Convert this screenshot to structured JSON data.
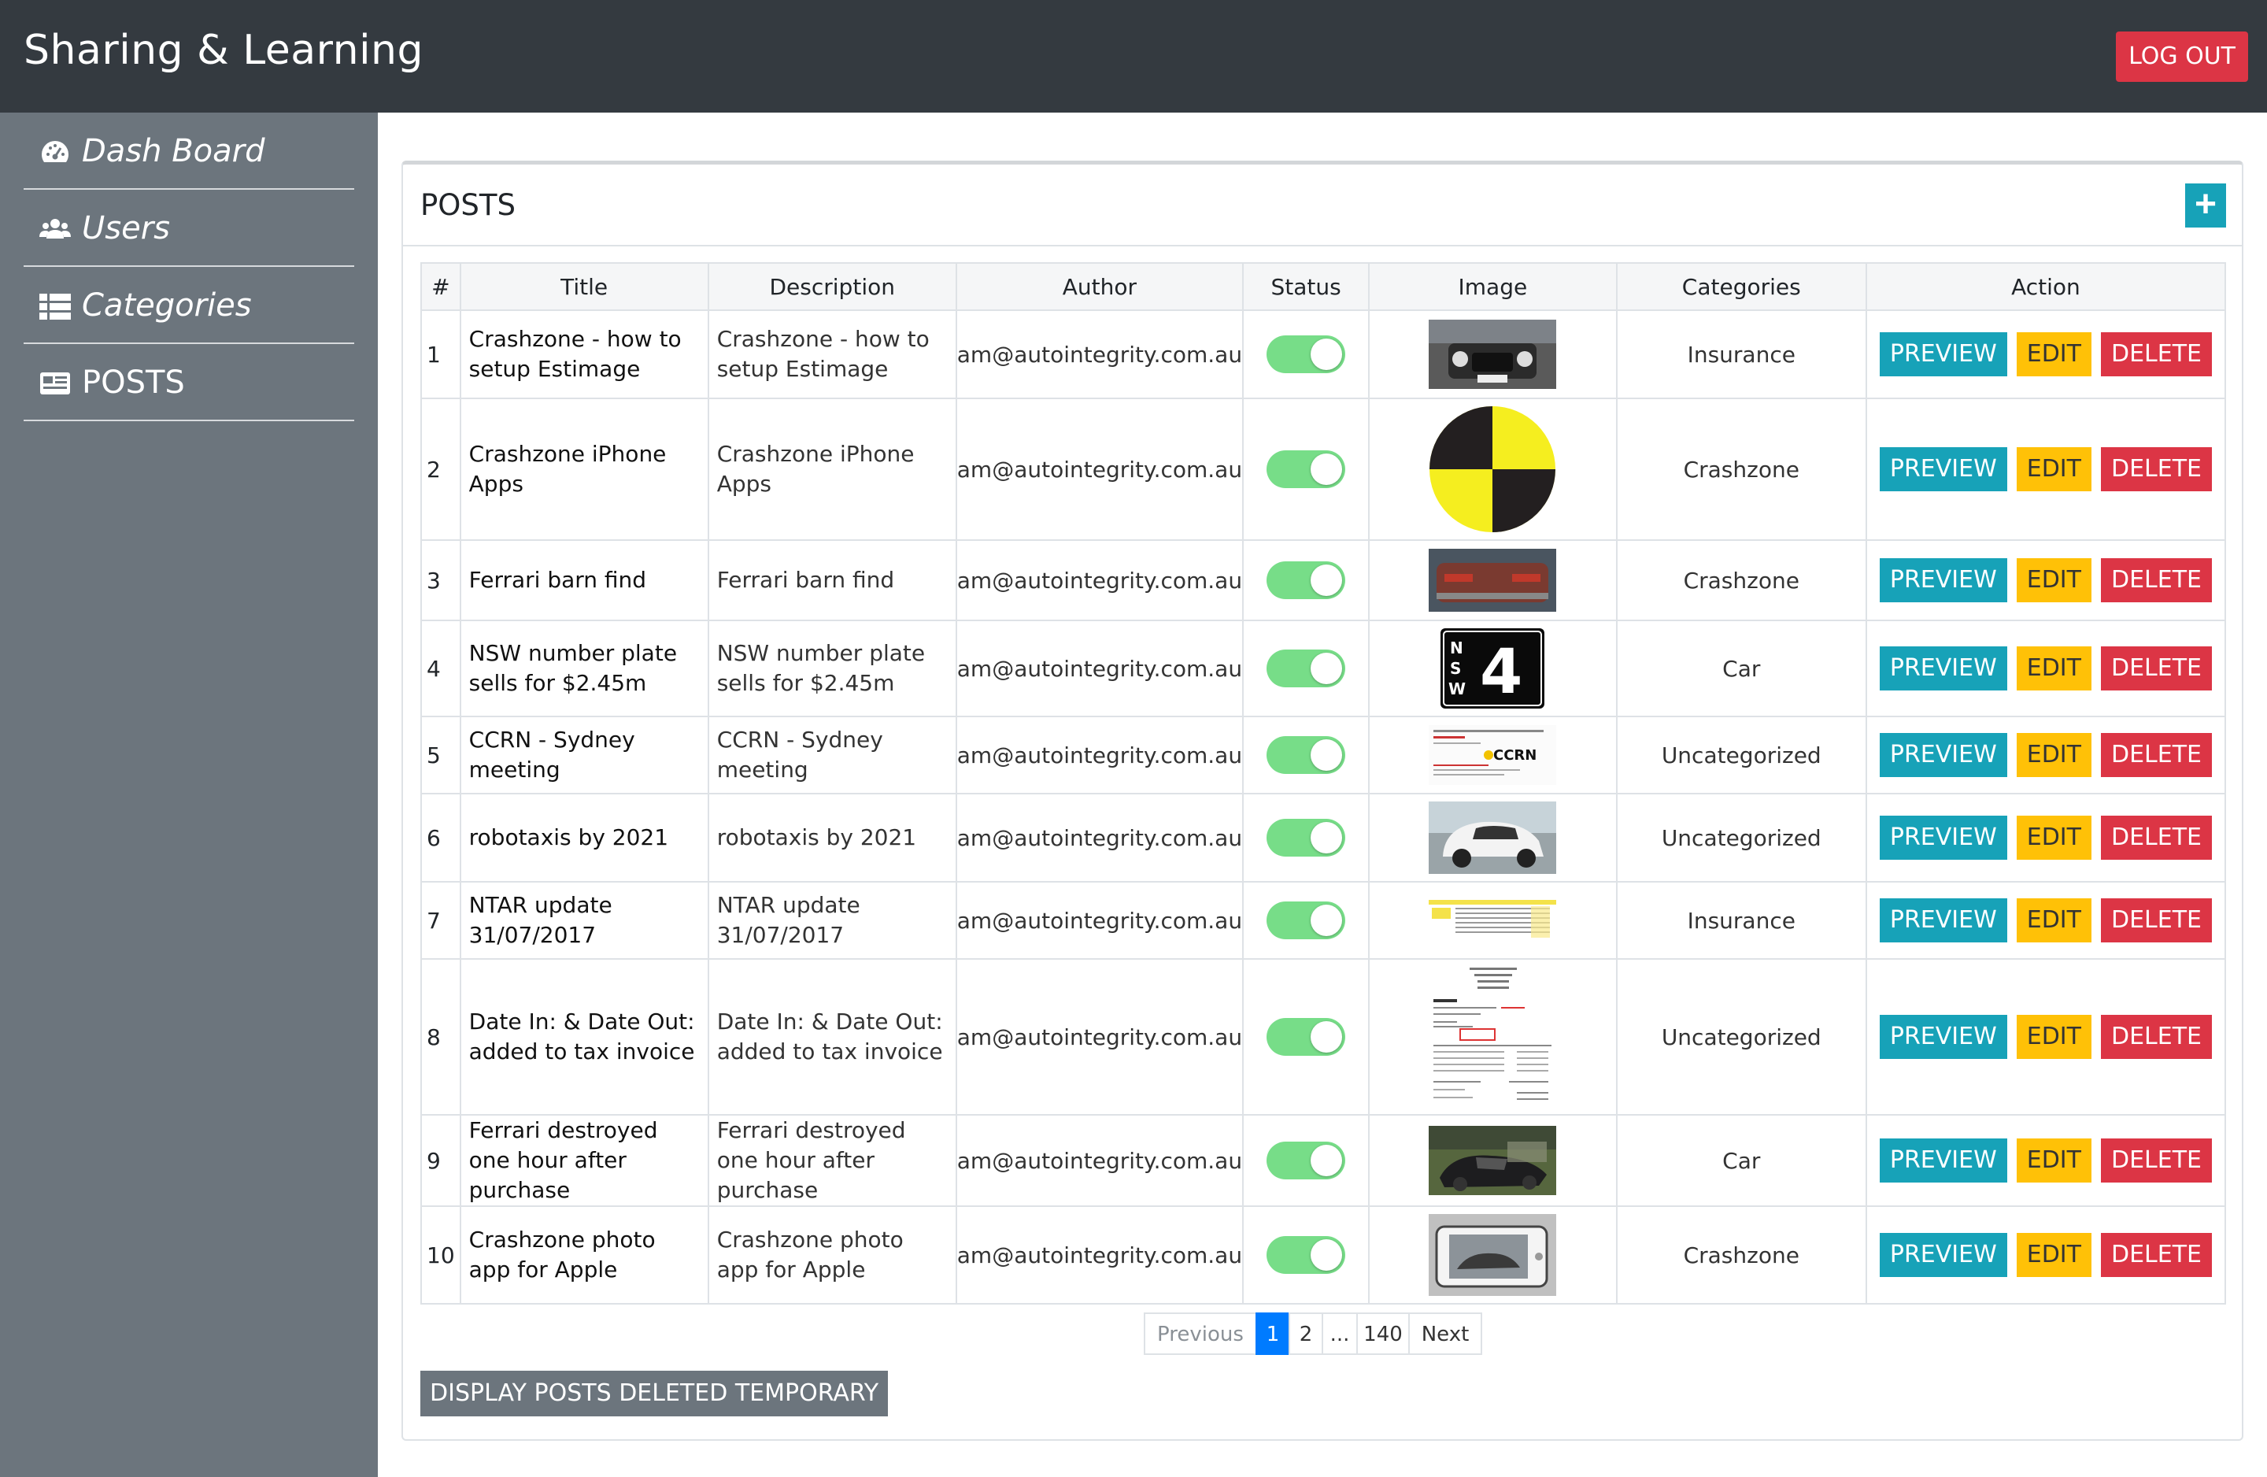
{
  "app": {
    "title": "Sharing & Learning",
    "logout_label": "LOG OUT"
  },
  "sidebar": {
    "items": [
      {
        "label": "Dash Board",
        "icon": "dashboard-icon"
      },
      {
        "label": "Users",
        "icon": "users-icon"
      },
      {
        "label": "Categories",
        "icon": "categories-icon"
      },
      {
        "label": "POSTS",
        "icon": "posts-icon",
        "active": true
      }
    ]
  },
  "posts": {
    "title": "POSTS",
    "add_label": "+",
    "columns": [
      "#",
      "Title",
      "Description",
      "Author",
      "Status",
      "Image",
      "Categories",
      "Action"
    ],
    "actions": {
      "preview": "PREVIEW",
      "edit": "EDIT",
      "delete": "DELETE"
    },
    "rows": [
      {
        "num": "1",
        "title": "Crashzone - how to setup Estimage",
        "description": "Crashzone - how to setup Estimage",
        "author": "am@autointegrity.com.au",
        "status": true,
        "image": "car-front-image",
        "category": "Insurance"
      },
      {
        "num": "2",
        "title": "Crashzone iPhone Apps",
        "description": "Crashzone iPhone Apps",
        "author": "am@autointegrity.com.au",
        "status": true,
        "image": "crash-test-symbol-image",
        "category": "Crashzone"
      },
      {
        "num": "3",
        "title": "Ferrari barn find",
        "description": "Ferrari barn find",
        "author": "am@autointegrity.com.au",
        "status": true,
        "image": "ferrari-rear-image",
        "category": "Crashzone"
      },
      {
        "num": "4",
        "title": "NSW number plate sells for $2.45m",
        "description": "NSW number plate sells for $2.45m",
        "author": "am@autointegrity.com.au",
        "status": true,
        "image": "nsw-plate-image",
        "category": "Car"
      },
      {
        "num": "5",
        "title": "CCRN - Sydney meeting",
        "description": "CCRN - Sydney meeting",
        "author": "am@autointegrity.com.au",
        "status": true,
        "image": "ccrn-flyer-image",
        "category": "Uncategorized"
      },
      {
        "num": "6",
        "title": "robotaxis by 2021",
        "description": "robotaxis by 2021",
        "author": "am@autointegrity.com.au",
        "status": true,
        "image": "robotaxi-image",
        "category": "Uncategorized"
      },
      {
        "num": "7",
        "title": "NTAR update 31/07/2017",
        "description": "NTAR update 31/07/2017",
        "author": "am@autointegrity.com.au",
        "status": true,
        "image": "spreadsheet-image",
        "category": "Insurance"
      },
      {
        "num": "8",
        "title": "Date In: & Date Out: added to tax invoice",
        "description": "Date In: & Date Out: added to tax invoice",
        "author": "am@autointegrity.com.au",
        "status": true,
        "image": "tax-invoice-image",
        "category": "Uncategorized"
      },
      {
        "num": "9",
        "title": "Ferrari destroyed one hour after purchase",
        "description": "Ferrari destroyed one hour after purchase",
        "author": "am@autointegrity.com.au",
        "status": true,
        "image": "wrecked-car-image",
        "category": "Car"
      },
      {
        "num": "10",
        "title": "Crashzone photo app for Apple",
        "description": "Crashzone photo app for Apple",
        "author": "am@autointegrity.com.au",
        "status": true,
        "image": "phone-photo-image",
        "category": "Crashzone"
      }
    ]
  },
  "pagination": {
    "previous": "Previous",
    "pages": [
      "1",
      "2",
      "...",
      "140"
    ],
    "current": "1",
    "next": "Next"
  },
  "footer": {
    "deleted_label": "DISPLAY POSTS DELETED TEMPORARY"
  },
  "colors": {
    "topbar": "#343a40",
    "sidebar": "#6c757d",
    "preview": "#17a2b8",
    "edit": "#ffc107",
    "delete": "#dc3545",
    "toggle_on": "#77dd88",
    "page_active": "#007bff"
  }
}
